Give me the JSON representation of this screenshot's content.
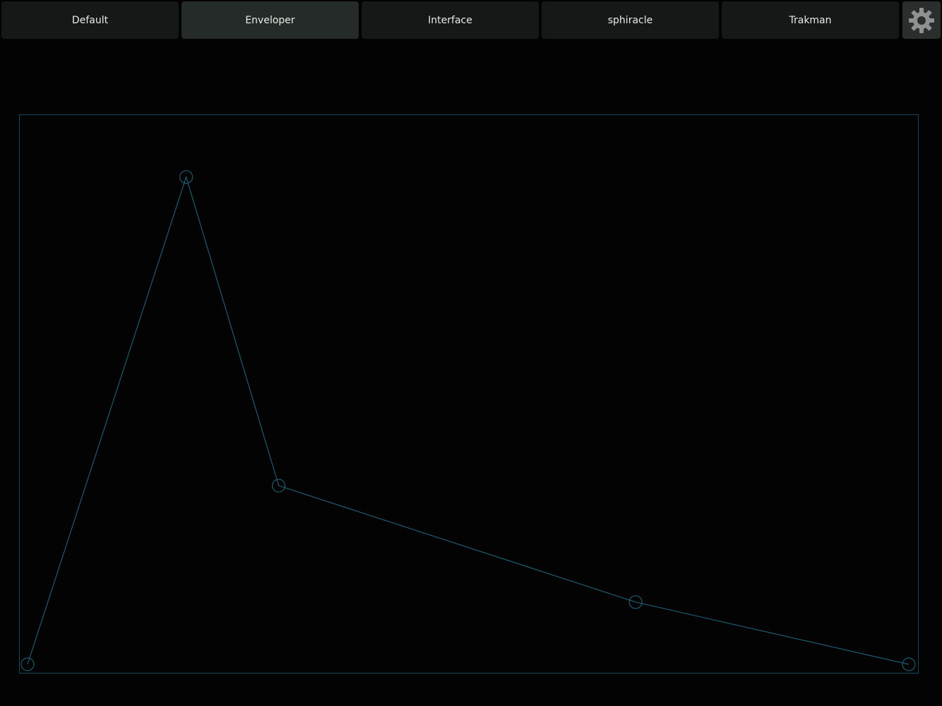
{
  "tabs": [
    {
      "label": "Default",
      "active": false
    },
    {
      "label": "Enveloper",
      "active": true
    },
    {
      "label": "Interface",
      "active": false
    },
    {
      "label": "sphiracle",
      "active": false
    },
    {
      "label": "Trakman",
      "active": false
    }
  ],
  "settings": {
    "icon": "gear-icon"
  },
  "envelope": {
    "line_color": "#1f5b70",
    "points": [
      {
        "x": 0.0,
        "y": 0.0
      },
      {
        "x": 0.18,
        "y": 0.9
      },
      {
        "x": 0.285,
        "y": 0.33
      },
      {
        "x": 0.69,
        "y": 0.115
      },
      {
        "x": 1.0,
        "y": 0.0
      }
    ]
  }
}
